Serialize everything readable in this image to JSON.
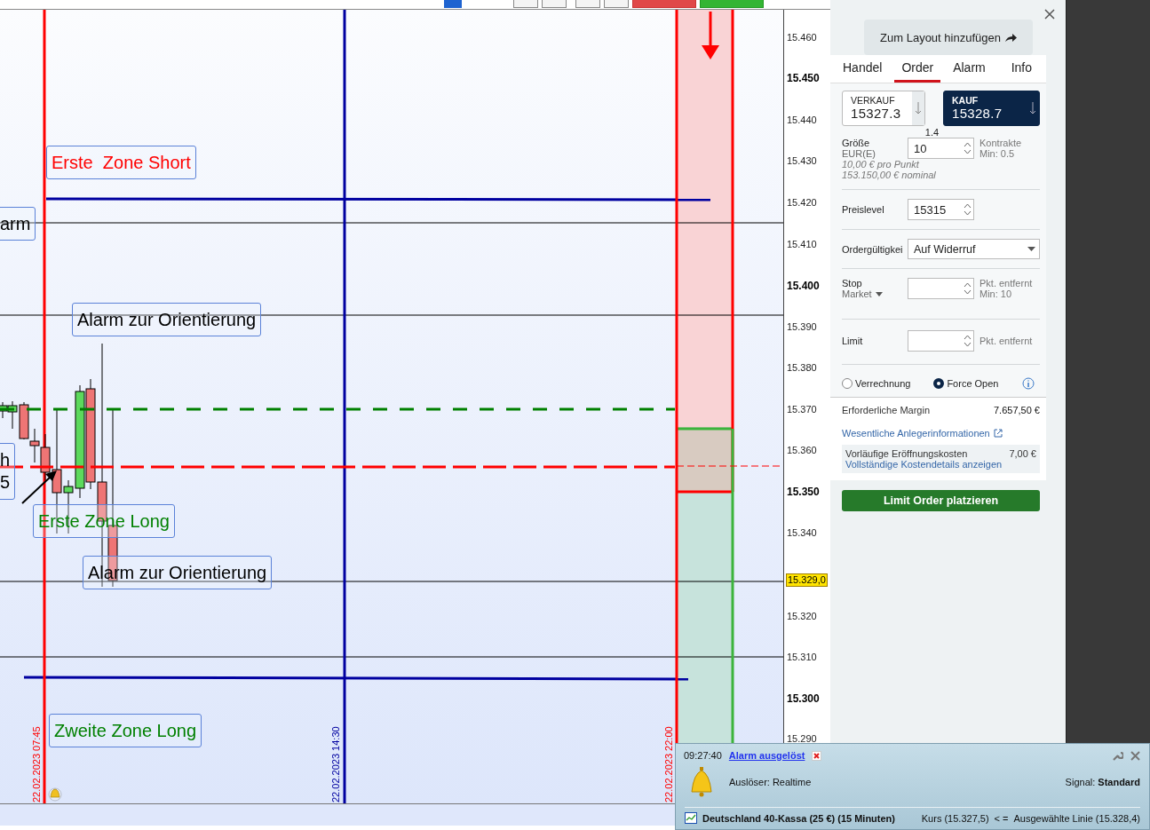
{
  "chart": {
    "annotations": [
      {
        "lines": [
          "Erste  Zone Short"
        ],
        "color": "#ff0000"
      },
      {
        "lines": [
          "arm"
        ],
        "color": "#000000"
      },
      {
        "lines": [
          "Alarm zur Orientierung"
        ],
        "color": "#000000"
      },
      {
        "lines": [
          "h",
          "5"
        ],
        "color": "#000000"
      },
      {
        "lines": [
          "Erste Zone Long"
        ],
        "color": "#008000"
      },
      {
        "lines": [
          "Alarm zur Orientierung"
        ],
        "color": "#000000"
      },
      {
        "lines": [
          "Zweite Zone Long"
        ],
        "color": "#008000"
      }
    ],
    "date_labels": [
      {
        "text": "22.02.2023 07:45",
        "color": "#ff0000"
      },
      {
        "text": "22.02.2023 14:30",
        "color": "#0000a0"
      },
      {
        "text": "22.02.2023 22:00",
        "color": "#ff0000"
      }
    ],
    "price_axis": [
      {
        "label": "15.460",
        "bold": false
      },
      {
        "label": "15.450",
        "bold": true
      },
      {
        "label": "15.440",
        "bold": false
      },
      {
        "label": "15.430",
        "bold": false
      },
      {
        "label": "15.420",
        "bold": false
      },
      {
        "label": "15.410",
        "bold": false
      },
      {
        "label": "15.400",
        "bold": true
      },
      {
        "label": "15.390",
        "bold": false
      },
      {
        "label": "15.380",
        "bold": false
      },
      {
        "label": "15.370",
        "bold": false
      },
      {
        "label": "15.360",
        "bold": false
      },
      {
        "label": "15.350",
        "bold": true
      },
      {
        "label": "15.340",
        "bold": false
      },
      {
        "label": "15.320",
        "bold": false
      },
      {
        "label": "15.310",
        "bold": false
      },
      {
        "label": "15.300",
        "bold": true
      },
      {
        "label": "15.290",
        "bold": false
      }
    ],
    "price_marker": "15.329,0"
  },
  "panel": {
    "layout_button": "Zum Layout hinzufügen",
    "tabs": [
      {
        "label": "Handel",
        "selected": false
      },
      {
        "label": "Order",
        "selected": true
      },
      {
        "label": "Alarm",
        "selected": false
      },
      {
        "label": "Info",
        "selected": false
      }
    ],
    "sell": {
      "label": "VERKAUF",
      "price": "15327.3"
    },
    "buy": {
      "label": "KAUF",
      "price": "15328.7"
    },
    "spread": "1.4",
    "size": {
      "label": "Größe",
      "sublabel": "EUR(E)",
      "value": "10",
      "unit": "Kontrakte",
      "min": "Min: 0.5",
      "per_point": "10,00 € pro Punkt",
      "nominal": "153.150,00 € nominal"
    },
    "price_level": {
      "label": "Preislevel",
      "value": "15315"
    },
    "validity": {
      "label": "Ordergültigkei",
      "value": "Auf Widerruf"
    },
    "stop": {
      "label": "Stop",
      "type": "Market",
      "unit": "Pkt. entfernt",
      "min": "Min: 10"
    },
    "limit": {
      "label": "Limit",
      "unit": "Pkt. entfernt"
    },
    "radios": [
      {
        "label": "Verrechnung",
        "selected": false
      },
      {
        "label": "Force Open",
        "selected": true
      }
    ],
    "margin": {
      "label": "Erforderliche Margin",
      "value": "7.657,50 €"
    },
    "info_link": "Wesentliche Anlegerinformationen",
    "costs": {
      "label": "Vorläufige Eröffnungskosten",
      "value": "7,00 €",
      "link": "Vollständige Kostendetails anzeigen"
    },
    "submit": "Limit Order platzieren"
  },
  "alert": {
    "time": "09:27:40",
    "title": "Alarm ausgelöst",
    "trigger": "Auslöser: Realtime",
    "signal": "Signal: **Standard**",
    "instrument": "Deutschland 40-Kassa (25 €) (15 Minuten)",
    "price": "Kurs (15.327,5)",
    "operator": "< =",
    "line": "Ausgewählte Linie (15.328,4)"
  }
}
